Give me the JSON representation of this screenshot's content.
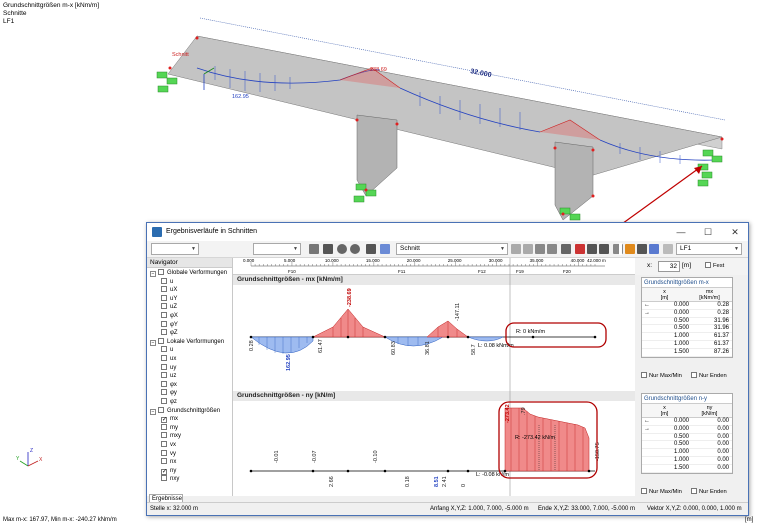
{
  "viewport": {
    "title_lines": [
      "Grundschnittgrößen m-x [kNm/m]",
      "Schnitte",
      "LF1"
    ],
    "dimension_label": "32.000",
    "value_labels": [
      "238.69",
      "162.95",
      "Schnitt"
    ],
    "bottom_left_text": "Max m-x: 167.97, Min m-x: -240.27 kNm/m",
    "bottom_right_text": "[m]",
    "axes": {
      "x": "X",
      "y": "Y",
      "z": "Z"
    }
  },
  "window": {
    "title": "Ergebnisverläufe in Schnitten",
    "controls": [
      "—",
      "☐",
      "✕"
    ],
    "toolbar": {
      "section_combo": "Schnitt",
      "loadcase_combo": "LF1"
    },
    "x_input": {
      "label": "x:",
      "value": "32",
      "unit": "[m]",
      "fixed_label": "Fest"
    },
    "ruler": {
      "ticks": [
        "0.000",
        "5.000",
        "10.000",
        "15.000",
        "20.000",
        "25.000",
        "30.000",
        "35.000",
        "40.000",
        "42.000 m"
      ],
      "elements": [
        "F10",
        "F11",
        "F12",
        "F19",
        "F20"
      ]
    }
  },
  "navigator": {
    "title": "Navigator",
    "tab_label": "Ergebnisse",
    "groups": [
      {
        "label": "Globale Verformungen",
        "items": [
          "u",
          "uX",
          "uY",
          "uZ",
          "φX",
          "φY",
          "φZ"
        ]
      },
      {
        "label": "Lokale Verformungen",
        "items": [
          "u",
          "ux",
          "uy",
          "uz",
          "φx",
          "φy",
          "φz"
        ]
      },
      {
        "label": "Grundschnittgrößen",
        "items": [
          {
            "label": "mx",
            "checked": true
          },
          {
            "label": "my",
            "checked": false
          },
          {
            "label": "mxy",
            "checked": false
          },
          {
            "label": "vx",
            "checked": false
          },
          {
            "label": "vy",
            "checked": false
          },
          {
            "label": "nx",
            "checked": false
          },
          {
            "label": "ny",
            "checked": true
          },
          {
            "label": "nxy",
            "checked": false
          }
        ]
      }
    ]
  },
  "diagram_mx": {
    "header": "Grundschnittgrößen - mx [kNm/m]",
    "labels": [
      "-238.69",
      "-147.11",
      "0.28",
      "162.95",
      "61.47",
      "60.83",
      "36.81",
      "58.7"
    ],
    "R_label": "R: 0 kNm/m",
    "L_label": "L: 0.08 kNm/m"
  },
  "diagram_ny": {
    "header": "Grundschnittgrößen - ny [kN/m]",
    "labels": [
      "-273.42",
      ".79",
      "-150.75",
      "-0.01",
      "-0.07",
      "-0.10",
      "2.66",
      "0.18",
      "2.41",
      "8.51",
      "0"
    ],
    "R_label": "R: -273.42 kN/m",
    "L_label": "L: -0.08 kN/m"
  },
  "table_mx": {
    "caption": "Grundschnittgrößen m-x",
    "col_x": "x\n[m]",
    "col_v": "mx\n[kNm/m]",
    "rows": [
      {
        "m": "←",
        "x": "0.000",
        "v": "0.28"
      },
      {
        "m": "→",
        "x": "0.000",
        "v": "0.28"
      },
      {
        "m": "",
        "x": "0.500",
        "v": "31.96"
      },
      {
        "m": "",
        "x": "0.500",
        "v": "31.96"
      },
      {
        "m": "",
        "x": "1.000",
        "v": "61.37"
      },
      {
        "m": "",
        "x": "1.000",
        "v": "61.37"
      },
      {
        "m": "",
        "x": "1.500",
        "v": "87.26"
      }
    ],
    "chk_max": "Nur Max/Min",
    "chk_end": "Nur Enden"
  },
  "table_ny": {
    "caption": "Grundschnittgrößen n-y",
    "col_x": "x\n[m]",
    "col_v": "ny\n[kN/m]",
    "rows": [
      {
        "m": "←",
        "x": "0.000",
        "v": "0.00"
      },
      {
        "m": "→",
        "x": "0.000",
        "v": "0.00"
      },
      {
        "m": "",
        "x": "0.500",
        "v": "0.00"
      },
      {
        "m": "",
        "x": "0.500",
        "v": "0.00"
      },
      {
        "m": "",
        "x": "1.000",
        "v": "0.00"
      },
      {
        "m": "",
        "x": "1.000",
        "v": "0.00"
      },
      {
        "m": "",
        "x": "1.500",
        "v": "0.00"
      }
    ],
    "chk_max": "Nur Max/Min",
    "chk_end": "Nur Enden"
  },
  "statusbar": {
    "stelle": "Stelle x: 32.000 m",
    "anfang": "Anfang X,Y,Z: 1.000, 7.000, -5.000 m",
    "ende": "Ende X,Y,Z: 33.000, 7.000, -5.000 m",
    "vektor": "Vektor X,Y,Z: 0.000, 0.000, 1.000 m"
  },
  "colors": {
    "accent": "#2b6cb0",
    "positive": "#e8787b",
    "negative": "#7fa6e6",
    "highlight": "#c00000"
  }
}
